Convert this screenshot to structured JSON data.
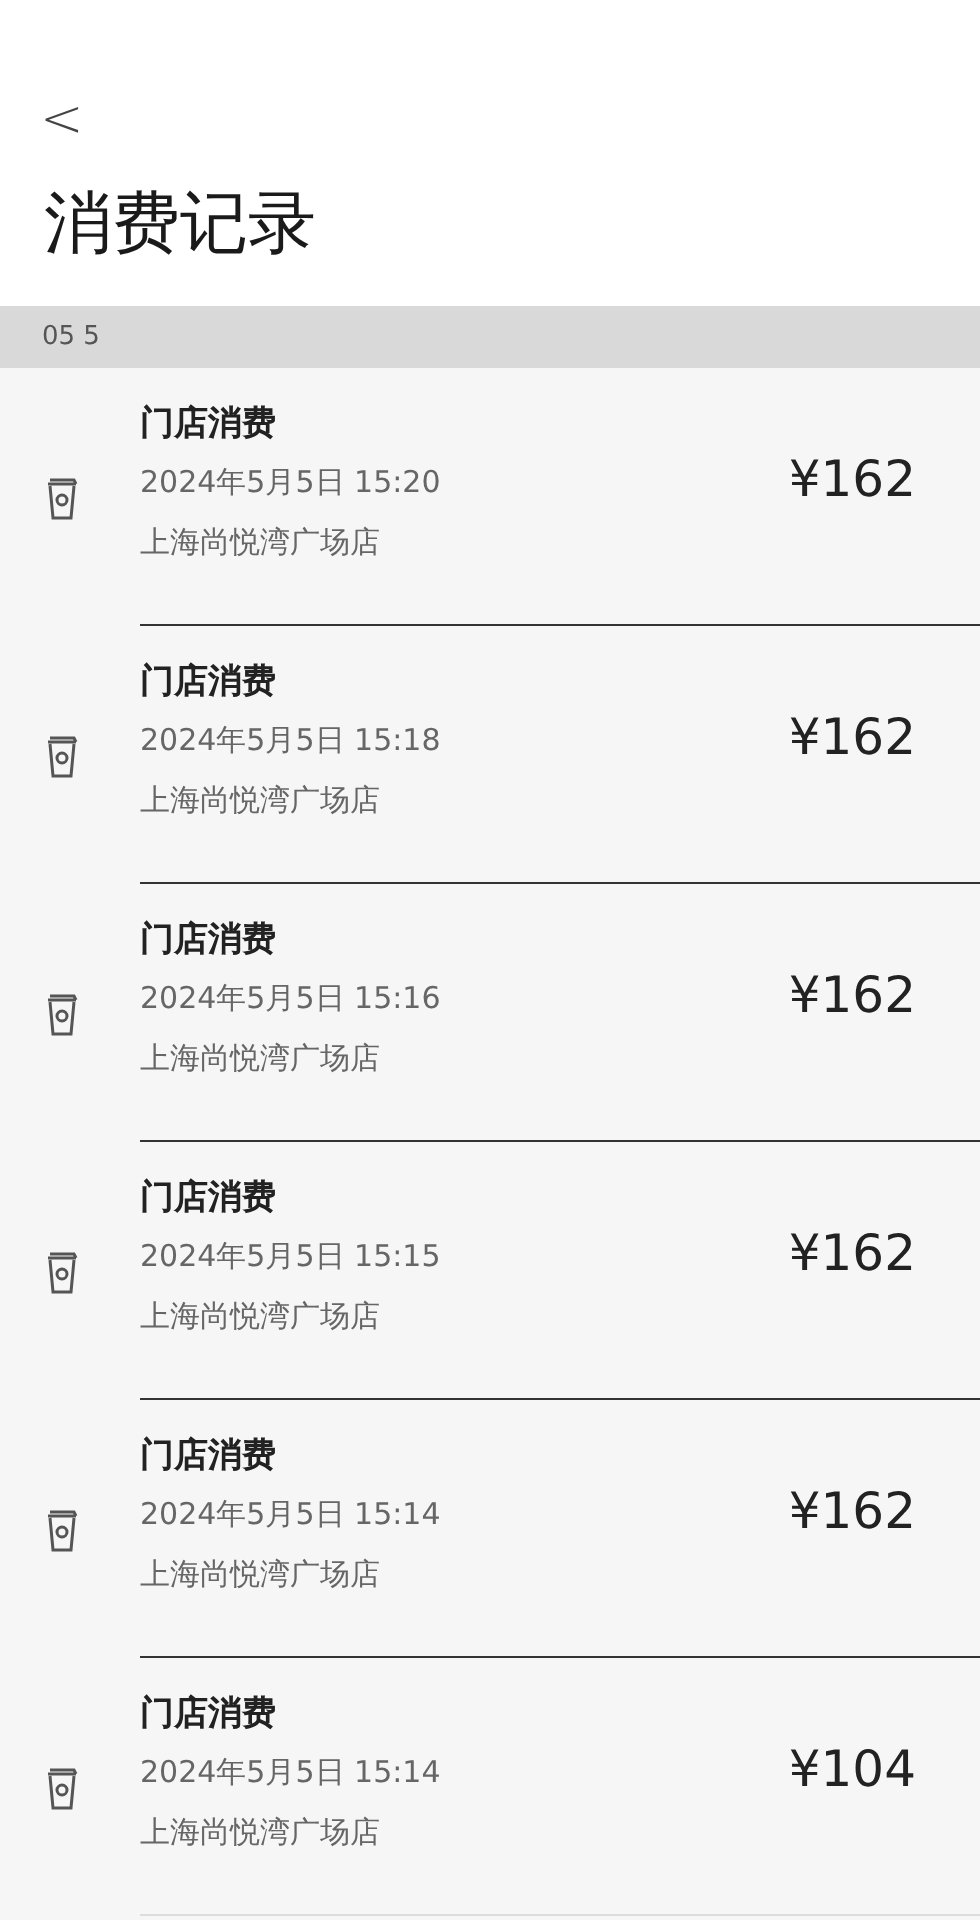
{
  "header": {
    "back": "<",
    "title": "消费记录"
  },
  "section": {
    "label": "05 5"
  },
  "records": [
    {
      "title": "门店消费",
      "time": "2024年5月5日 15:20",
      "store": "上海尚悦湾广场店",
      "amount": "¥162"
    },
    {
      "title": "门店消费",
      "time": "2024年5月5日 15:18",
      "store": "上海尚悦湾广场店",
      "amount": "¥162"
    },
    {
      "title": "门店消费",
      "time": "2024年5月5日 15:16",
      "store": "上海尚悦湾广场店",
      "amount": "¥162"
    },
    {
      "title": "门店消费",
      "time": "2024年5月5日 15:15",
      "store": "上海尚悦湾广场店",
      "amount": "¥162"
    },
    {
      "title": "门店消费",
      "time": "2024年5月5日 15:14",
      "store": "上海尚悦湾广场店",
      "amount": "¥162"
    },
    {
      "title": "门店消费",
      "time": "2024年5月5日 15:14",
      "store": "上海尚悦湾广场店",
      "amount": "¥104"
    }
  ]
}
